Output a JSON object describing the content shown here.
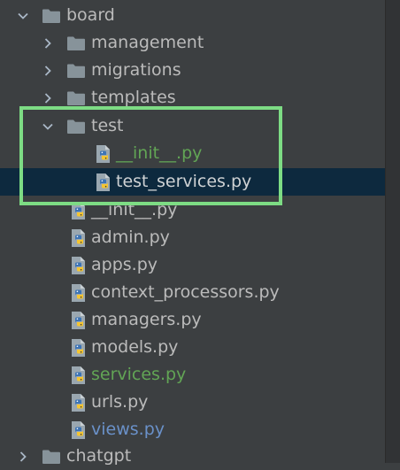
{
  "accent": {
    "highlight": "#7ddc84",
    "selection": "#0d293e",
    "green_text": "#62a555",
    "blue_text": "#6a91c9",
    "folder": "#87939a"
  },
  "tree": {
    "board": {
      "label": "board",
      "expanded": true,
      "icon": "folder-icon"
    },
    "management": {
      "label": "management",
      "icon": "folder-icon"
    },
    "migrations": {
      "label": "migrations",
      "icon": "folder-icon"
    },
    "templates": {
      "label": "templates",
      "icon": "folder-icon"
    },
    "test": {
      "label": "test",
      "expanded": true,
      "icon": "folder-icon"
    },
    "test_init": {
      "label": "__init__.py",
      "icon": "python-file-icon"
    },
    "test_services": {
      "label": "test_services.py",
      "icon": "python-file-icon",
      "selected": true
    },
    "init": {
      "label": "__init__.py",
      "icon": "python-file-icon"
    },
    "admin": {
      "label": "admin.py",
      "icon": "python-file-icon"
    },
    "apps": {
      "label": "apps.py",
      "icon": "python-file-icon"
    },
    "context_processors": {
      "label": "context_processors.py",
      "icon": "python-file-icon"
    },
    "managers": {
      "label": "managers.py",
      "icon": "python-file-icon"
    },
    "models": {
      "label": "models.py",
      "icon": "python-file-icon"
    },
    "services": {
      "label": "services.py",
      "icon": "python-file-icon"
    },
    "urls": {
      "label": "urls.py",
      "icon": "python-file-icon"
    },
    "views": {
      "label": "views.py",
      "icon": "python-file-icon"
    },
    "chatgpt": {
      "label": "chatgpt",
      "icon": "folder-icon"
    }
  }
}
